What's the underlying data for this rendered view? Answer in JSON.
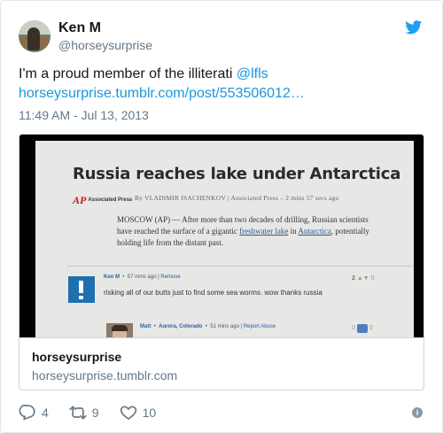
{
  "author": {
    "name": "Ken M",
    "handle": "@horseysurprise"
  },
  "tweet": {
    "text_prefix": "I'm a proud member of the illiterati ",
    "mention": "@lfls",
    "link": "horseysurprise.tumblr.com/post/553506012…",
    "timestamp": "11:49 AM - Jul 13, 2013"
  },
  "card": {
    "title": "horseysurprise",
    "domain": "horseysurprise.tumblr.com",
    "image": {
      "headline": "Russia reaches lake under Antarctica",
      "ap_mark": "AP",
      "ap_word": "Associated Press",
      "byline": "By VLADIMIR ISACHENKOV | Associated Press – 2 mins 57 secs ago",
      "article_before": "MOSCOW (AP) — After more than two decades of drilling, Russian scientists have reached the surface of a gigantic ",
      "article_link1": "freshwater lake",
      "article_mid": " in ",
      "article_link2": "Antarctica",
      "article_after": ", potentially holding life from the distant past.",
      "comment1": {
        "user": "Ken M",
        "time": "57 mins ago",
        "action": "Remove",
        "text": "risking all of our butts just to find some sea worms. wow thanks russia",
        "votes_up": "2",
        "votes_down": "0"
      },
      "comment2": {
        "user": "Matt",
        "location": "Aurora, Colorado",
        "time": "51 mins ago",
        "action": "Report Abuse",
        "votes_left": "0",
        "votes_right": "0"
      }
    }
  },
  "actions": {
    "replies": "4",
    "retweets": "9",
    "likes": "10"
  },
  "colors": {
    "link": "#1b95e0",
    "secondary_text": "#657786",
    "border": "#ccd6dd",
    "twitter_blue": "#1da1f2"
  }
}
